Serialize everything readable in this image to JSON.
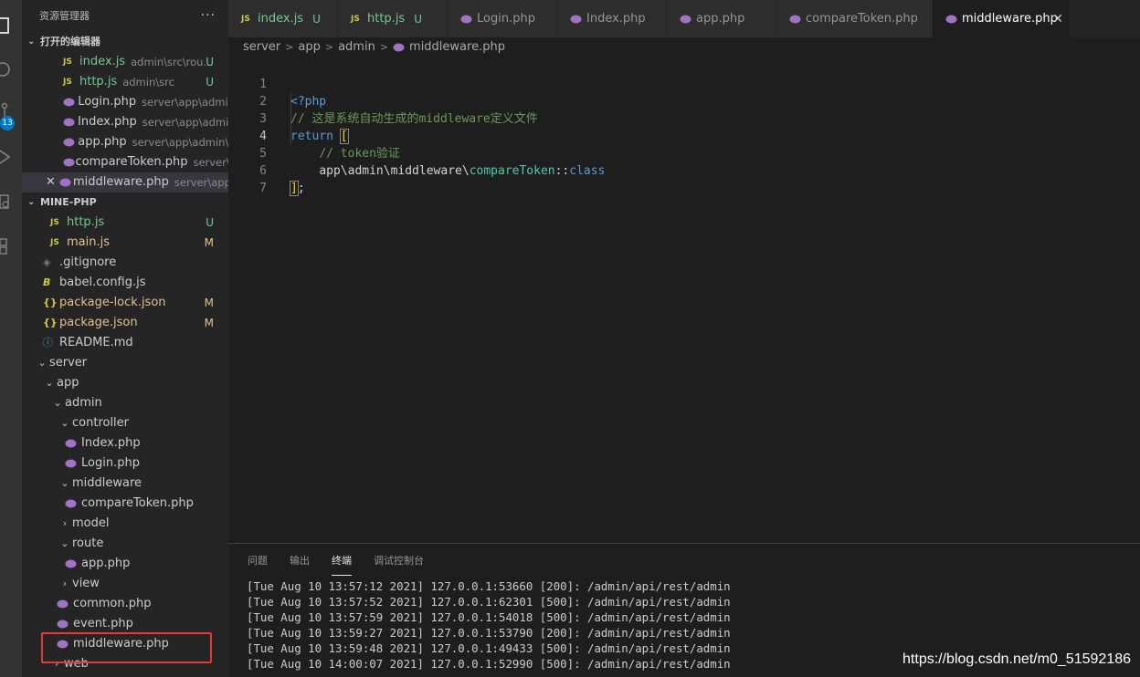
{
  "sidebar": {
    "title": "资源管理器",
    "more": "···",
    "open_editors": {
      "header": "打开的编辑器",
      "items": [
        {
          "icon": "JS",
          "name": "index.js",
          "desc": "admin\\src\\rou...",
          "status": "U"
        },
        {
          "icon": "JS",
          "name": "http.js",
          "desc": "admin\\src",
          "status": "U"
        },
        {
          "name": "Login.php",
          "desc": "server\\app\\admi..."
        },
        {
          "name": "Index.php",
          "desc": "server\\app\\admi..."
        },
        {
          "name": "app.php",
          "desc": "server\\app\\admin\\..."
        },
        {
          "name": "compareToken.php",
          "desc": "server\\..."
        },
        {
          "name": "middleware.php",
          "desc": "server\\app..."
        }
      ]
    },
    "project": {
      "header": "MINE-PHP",
      "files": [
        {
          "icon": "JS",
          "name": "http.js",
          "status": "U"
        },
        {
          "icon": "JS",
          "name": "main.js",
          "status": "M"
        },
        {
          "name": ".gitignore"
        },
        {
          "name": "babel.config.js"
        },
        {
          "icon": "{}",
          "name": "package-lock.json",
          "status": "M"
        },
        {
          "icon": "{}",
          "name": "package.json",
          "status": "M"
        },
        {
          "name": "README.md"
        }
      ],
      "tree": [
        {
          "name": "server"
        },
        {
          "name": "app"
        },
        {
          "name": "admin"
        },
        {
          "name": "controller"
        },
        {
          "name": "Index.php"
        },
        {
          "name": "Login.php"
        },
        {
          "name": "middleware"
        },
        {
          "name": "compareToken.php"
        },
        {
          "name": "model"
        },
        {
          "name": "route"
        },
        {
          "name": "app.php"
        },
        {
          "name": "view"
        },
        {
          "name": "common.php"
        },
        {
          "name": "event.php"
        },
        {
          "name": "middleware.php"
        },
        {
          "name": "web"
        }
      ]
    }
  },
  "activity": {
    "badge": "13"
  },
  "tabs": [
    {
      "icon": "JS",
      "label": "index.js",
      "status": "U"
    },
    {
      "icon": "JS",
      "label": "http.js",
      "status": "U"
    },
    {
      "label": "Login.php"
    },
    {
      "label": "Index.php"
    },
    {
      "label": "app.php"
    },
    {
      "label": "compareToken.php"
    },
    {
      "label": "middleware.php",
      "close": "✕"
    }
  ],
  "breadcrumb": [
    "server",
    "app",
    "admin",
    "middleware.php"
  ],
  "editor": {
    "line_numbers": [
      "1",
      "2",
      "3",
      "4",
      "5",
      "6",
      "7"
    ],
    "lines": {
      "l1": "<?php",
      "l2": "// 这是系统自动生成的middleware定义文件",
      "l3_kw": "return",
      "l3_br": "[",
      "l4": "// token验证",
      "l5_ns": "app\\admin\\middleware\\",
      "l5_cls": "compareToken",
      "l5_op": "::",
      "l5_kw": "class",
      "l6_br": "]",
      "l6_end": ";"
    }
  },
  "panel": {
    "tabs": [
      "问题",
      "输出",
      "终端",
      "调试控制台"
    ],
    "terminal": [
      "[Tue Aug 10 13:57:12 2021] 127.0.0.1:53660 [200]: /admin/api/rest/admin",
      "[Tue Aug 10 13:57:52 2021] 127.0.0.1:62301 [500]: /admin/api/rest/admin",
      "[Tue Aug 10 13:57:59 2021] 127.0.0.1:54018 [500]: /admin/api/rest/admin",
      "[Tue Aug 10 13:59:27 2021] 127.0.0.1:53790 [200]: /admin/api/rest/admin",
      "[Tue Aug 10 13:59:48 2021] 127.0.0.1:49433 [500]: /admin/api/rest/admin",
      "[Tue Aug 10 14:00:07 2021] 127.0.0.1:52990 [500]: /admin/api/rest/admin"
    ]
  },
  "watermark": "https://blog.csdn.net/m0_51592186",
  "colors": {
    "accent": "#007acc",
    "untracked": "#73c991",
    "modified": "#e2c08d",
    "highlight_box": "#e53935"
  }
}
